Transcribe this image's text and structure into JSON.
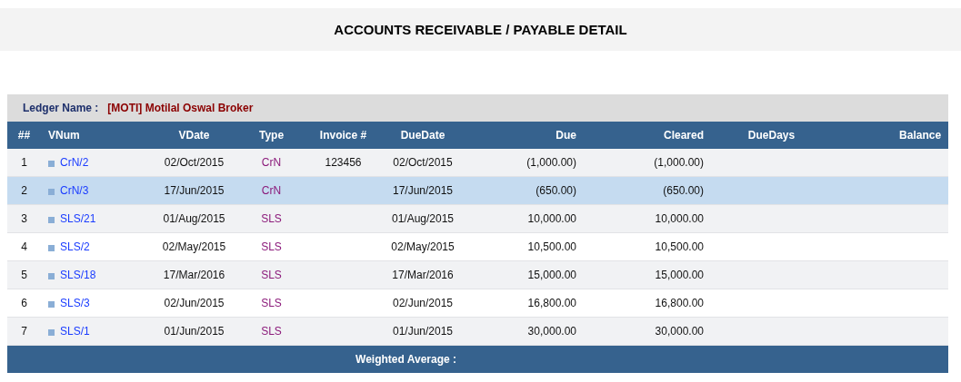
{
  "title": "ACCOUNTS RECEIVABLE / PAYABLE DETAIL",
  "ledger": {
    "label": "Ledger Name :",
    "value": "[MOTI] Motilal Oswal Broker"
  },
  "table": {
    "columns": [
      "##",
      "VNum",
      "VDate",
      "Type",
      "Invoice #",
      "DueDate",
      "Due",
      "Cleared",
      "DueDays",
      "Balance"
    ],
    "rows": [
      {
        "num": "1",
        "vnum": "CrN/2",
        "vdate": "02/Oct/2015",
        "type": "CrN",
        "invoice": "123456",
        "due_date": "02/Oct/2015",
        "due": "(1,000.00)",
        "cleared": "(1,000.00)",
        "selected": false
      },
      {
        "num": "2",
        "vnum": "CrN/3",
        "vdate": "17/Jun/2015",
        "type": "CrN",
        "due_date": "17/Jun/2015",
        "due": "(650.00)",
        "cleared": "(650.00)",
        "selected": true
      },
      {
        "num": "3",
        "vnum": "SLS/21",
        "vdate": "01/Aug/2015",
        "type": "SLS",
        "due_date": "01/Aug/2015",
        "due": "10,000.00",
        "cleared": "10,000.00",
        "selected": false
      },
      {
        "num": "4",
        "vnum": "SLS/2",
        "vdate": "02/May/2015",
        "type": "SLS",
        "due_date": "02/May/2015",
        "due": "10,500.00",
        "cleared": "10,500.00",
        "selected": false
      },
      {
        "num": "5",
        "vnum": "SLS/18",
        "vdate": "17/Mar/2016",
        "type": "SLS",
        "due_date": "17/Mar/2016",
        "due": "15,000.00",
        "cleared": "15,000.00",
        "selected": false
      },
      {
        "num": "6",
        "vnum": "SLS/3",
        "vdate": "02/Jun/2015",
        "type": "SLS",
        "due_date": "02/Jun/2015",
        "due": "16,800.00",
        "cleared": "16,800.00",
        "selected": false
      },
      {
        "num": "7",
        "vnum": "SLS/1",
        "vdate": "01/Jun/2015",
        "type": "SLS",
        "due_date": "01/Jun/2015",
        "due": "30,000.00",
        "cleared": "30,000.00",
        "selected": false
      }
    ],
    "footer": "Weighted Average :"
  }
}
